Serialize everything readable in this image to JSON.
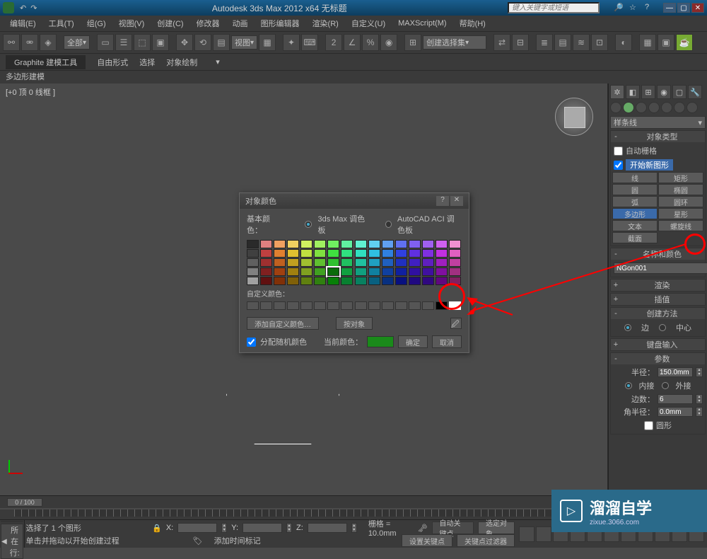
{
  "title": "Autodesk 3ds Max  2012 x64   无标题",
  "search_placeholder": "键入关键字或短语",
  "menus": [
    "编辑(E)",
    "工具(T)",
    "组(G)",
    "视图(V)",
    "创建(C)",
    "修改器",
    "动画",
    "图形编辑器",
    "渲染(R)",
    "自定义(U)",
    "MAXScript(M)",
    "帮助(H)"
  ],
  "toolbar_all": "全部",
  "toolbar_view": "视图",
  "toolbar_selset": "创建选择集",
  "subtabs": {
    "graphite": "Graphite 建模工具",
    "freeform": "自由形式",
    "select": "选择",
    "objpaint": "对象绘制"
  },
  "poly_mode": "多边形建模",
  "viewport_label": "[+0 顶 0 线框 ]",
  "timeline_pos": "0 / 100",
  "status": {
    "selected": "选择了 1 个图形",
    "hint": "单击并拖动以开始创建过程",
    "grid_label": "栅格 = 10.0mm",
    "autokey": "自动关键点",
    "setkey": "设置关键点",
    "selobj": "选定对象",
    "keyfilter": "关键点过滤器",
    "add_time": "添加时间标记",
    "location_label": "所在行:"
  },
  "dialog": {
    "title": "对象颜色",
    "basic_label": "基本颜色：",
    "palette3ds": "3ds Max 调色板",
    "paletteACI": "AutoCAD ACI 调色板",
    "custom_label": "自定义颜色：",
    "add_custom": "添加自定义颜色…",
    "by_object": "按对象",
    "assign_random": "分配随机颜色",
    "current_label": "当前颜色：",
    "ok": "确定",
    "cancel": "取消"
  },
  "cmd": {
    "spline_cat": "样条线",
    "obj_type": "对象类型",
    "auto_grid": "自动栅格",
    "start_new": "开始新图形",
    "shapes": {
      "line": "线",
      "rect": "矩形",
      "circle": "圆",
      "ellipse": "椭圆",
      "arc": "弧",
      "donut": "圆环",
      "ngon": "多边形",
      "star": "星形",
      "text": "文本",
      "helix": "螺旋线",
      "section": "截面"
    },
    "name_color": "名称和颜色",
    "obj_name": "NGon001",
    "render": "渲染",
    "interp": "插值",
    "create_method": "创建方法",
    "edge": "边",
    "center": "中心",
    "keyboard": "键盘输入",
    "params": "参数",
    "radius_label": "半径：",
    "radius_val": "150.0mm",
    "inscribe": "内接",
    "circumscribe": "外接",
    "sides_label": "边数：",
    "sides_val": "6",
    "corner_label": "角半径：",
    "corner_val": "0.0mm",
    "circular": "圆形"
  },
  "watermark": {
    "main": "溜溜自学",
    "sub": "zixue.3066.com"
  },
  "palette_colors": [
    [
      "#2a2a2a",
      "#e08080",
      "#f0a060",
      "#f0d060",
      "#d0f060",
      "#a0f060",
      "#70f060",
      "#60f0a0",
      "#60f0d0",
      "#60d0f0",
      "#60a0f0",
      "#6070f0",
      "#8060f0",
      "#a060f0",
      "#d060f0",
      "#f090d0"
    ],
    [
      "#404040",
      "#c04040",
      "#e08030",
      "#e0c030",
      "#c0e040",
      "#80e040",
      "#40e040",
      "#30e080",
      "#30e0c0",
      "#30c0e0",
      "#3080e0",
      "#3040e0",
      "#6030e0",
      "#8030e0",
      "#c030e0",
      "#e060c0"
    ],
    [
      "#606060",
      "#a03030",
      "#c06020",
      "#c0a020",
      "#a0c030",
      "#60c030",
      "#30c030",
      "#20c060",
      "#20c0a0",
      "#20a0c0",
      "#2060c0",
      "#2030c0",
      "#4020c0",
      "#6020c0",
      "#a020c0",
      "#c040a0"
    ],
    [
      "#808080",
      "#802020",
      "#a04010",
      "#a08010",
      "#80a020",
      "#40a020",
      "#0b6b0b",
      "#10a040",
      "#10a080",
      "#1080a0",
      "#1040a0",
      "#1020a0",
      "#3010a0",
      "#4010a0",
      "#8010a0",
      "#a03080"
    ],
    [
      "#a0a0a0",
      "#601010",
      "#803008",
      "#806008",
      "#608010",
      "#308010",
      "#088008",
      "#088030",
      "#088060",
      "#086080",
      "#083080",
      "#081080",
      "#200880",
      "#300880",
      "#600880",
      "#802060"
    ]
  ]
}
